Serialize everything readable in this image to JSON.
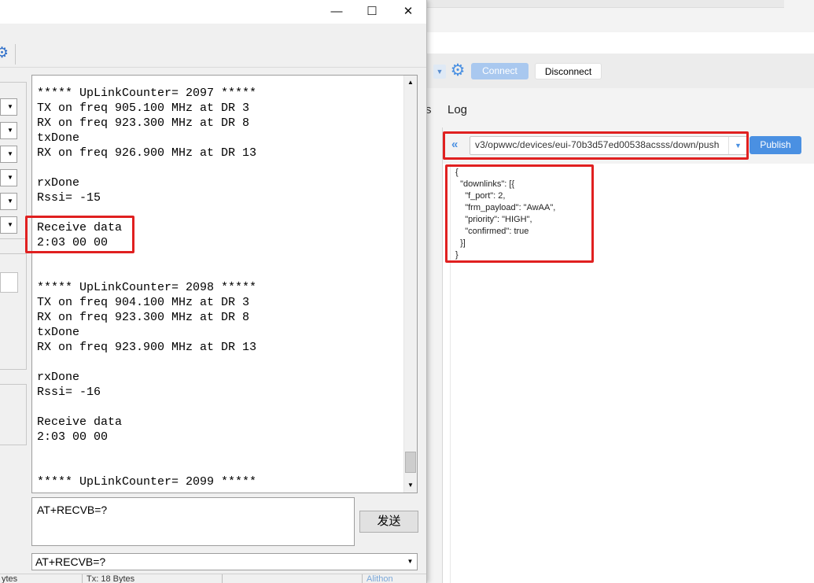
{
  "mqtt": {
    "buttons": {
      "connect": "Connect",
      "disconnect": "Disconnect",
      "publish": "Publish"
    },
    "tabs": {
      "partial": "s",
      "log": "Log"
    },
    "topic": "v3/opwwc/devices/eui-70b3d57ed00538acsss/down/push",
    "payload": "{\n  \"downlinks\": [{\n    \"f_port\": 2,\n    \"frm_payload\": \"AwAA\",\n    \"priority\": \"HIGH\",\n    \"confirmed\": true\n  }]\n}",
    "icons": {
      "gear": "gear-icon",
      "chevrons": "double-chevron-left-icon",
      "dropdown": "chevron-down-icon"
    },
    "colors": {
      "accent": "#4a90e2",
      "highlight": "#e02020"
    }
  },
  "serial": {
    "window_controls": {
      "minimize": "—",
      "maximize": "☐",
      "close": "✕"
    },
    "output_text": "***** UpLinkCounter= 2097 *****\nTX on freq 905.100 MHz at DR 3\nRX on freq 923.300 MHz at DR 8\ntxDone\nRX on freq 926.900 MHz at DR 13\n\nrxDone\nRssi= -15\n\nReceive data\n2:03 00 00\n\n\n***** UpLinkCounter= 2098 *****\nTX on freq 904.100 MHz at DR 3\nRX on freq 923.300 MHz at DR 8\ntxDone\nRX on freq 923.900 MHz at DR 13\n\nrxDone\nRssi= -16\n\nReceive data\n2:03 00 00\n\n\n***** UpLinkCounter= 2099 *****",
    "input_text": "AT+RECVB=?",
    "send_label": "发送",
    "command_value": "AT+RECVB=?",
    "status": {
      "seg1": "ytes",
      "seg2": "Tx: 18 Bytes",
      "seg3": "Alithon"
    }
  }
}
